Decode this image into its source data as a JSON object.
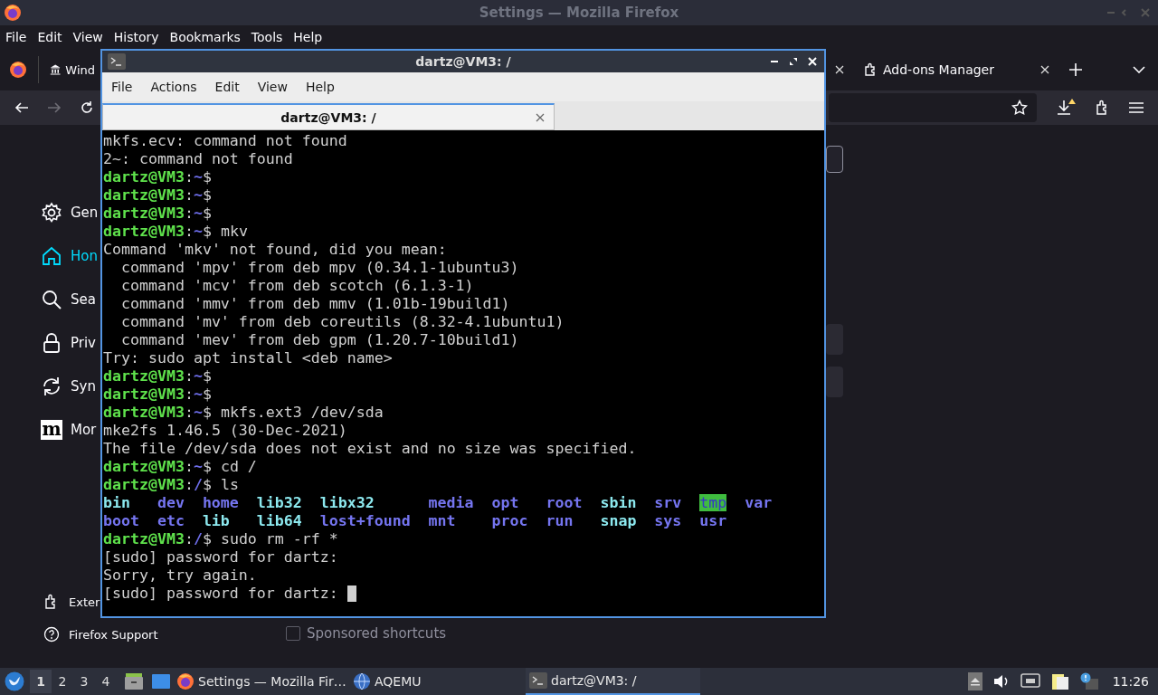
{
  "window": {
    "title": "Settings — Mozilla Firefox"
  },
  "menu": [
    "File",
    "Edit",
    "View",
    "History",
    "Bookmarks",
    "Tools",
    "Help"
  ],
  "tabs": [
    {
      "label": "Wind",
      "selected": false
    },
    {
      "selected": false
    },
    {
      "label": "Add-ons Manager",
      "selected": false
    }
  ],
  "sidebar": {
    "items": [
      {
        "label": "Gen",
        "selected": false
      },
      {
        "label": "Hon",
        "selected": true
      },
      {
        "label": "Sea",
        "selected": false
      },
      {
        "label": "Priv",
        "selected": false
      },
      {
        "label": "Syn",
        "selected": false
      },
      {
        "label": "Mor",
        "selected": false,
        "logo_text": "m"
      }
    ],
    "footer": [
      {
        "label": "Exter"
      },
      {
        "label": "Firefox Support"
      }
    ]
  },
  "sponsored": {
    "label": "Sponsored shortcuts",
    "checked": false,
    "disabled": true
  },
  "terminal": {
    "title": "dartz@VM3: /",
    "menu": [
      "File",
      "Actions",
      "Edit",
      "View",
      "Help"
    ],
    "tab": {
      "label": "dartz@VM3: /",
      "selected": true
    },
    "lines": [
      {
        "kind": "text",
        "segments": [
          {
            "text": "mkfs.ecv: command not found",
            "kind": "plain"
          }
        ]
      },
      {
        "kind": "text",
        "segments": [
          {
            "text": "2~: command not found",
            "kind": "plain"
          }
        ]
      },
      {
        "kind": "text",
        "segments": [
          {
            "text": "dartz@VM3",
            "kind": "user"
          },
          {
            "text": ":",
            "kind": "plain"
          },
          {
            "text": "~",
            "kind": "path"
          },
          {
            "text": "$",
            "kind": "plain"
          }
        ]
      },
      {
        "kind": "text",
        "segments": [
          {
            "text": "dartz@VM3",
            "kind": "user"
          },
          {
            "text": ":",
            "kind": "plain"
          },
          {
            "text": "~",
            "kind": "path"
          },
          {
            "text": "$",
            "kind": "plain"
          }
        ]
      },
      {
        "kind": "text",
        "segments": [
          {
            "text": "dartz@VM3",
            "kind": "user"
          },
          {
            "text": ":",
            "kind": "plain"
          },
          {
            "text": "~",
            "kind": "path"
          },
          {
            "text": "$",
            "kind": "plain"
          }
        ]
      },
      {
        "kind": "text",
        "segments": [
          {
            "text": "dartz@VM3",
            "kind": "user"
          },
          {
            "text": ":",
            "kind": "plain"
          },
          {
            "text": "~",
            "kind": "path"
          },
          {
            "text": "$ mkv",
            "kind": "plain"
          }
        ]
      },
      {
        "kind": "text",
        "segments": [
          {
            "text": "Command 'mkv' not found, did you mean:",
            "kind": "plain"
          }
        ]
      },
      {
        "kind": "text",
        "segments": [
          {
            "text": "  command 'mpv' from deb mpv (0.34.1-1ubuntu3)",
            "kind": "plain"
          }
        ]
      },
      {
        "kind": "text",
        "segments": [
          {
            "text": "  command 'mcv' from deb scotch (6.1.3-1)",
            "kind": "plain"
          }
        ]
      },
      {
        "kind": "text",
        "segments": [
          {
            "text": "  command 'mmv' from deb mmv (1.01b-19build1)",
            "kind": "plain"
          }
        ]
      },
      {
        "kind": "text",
        "segments": [
          {
            "text": "  command 'mv' from deb coreutils (8.32-4.1ubuntu1)",
            "kind": "plain"
          }
        ]
      },
      {
        "kind": "text",
        "segments": [
          {
            "text": "  command 'mev' from deb gpm (1.20.7-10build1)",
            "kind": "plain"
          }
        ]
      },
      {
        "kind": "text",
        "segments": [
          {
            "text": "Try: sudo apt install <deb name>",
            "kind": "plain"
          }
        ]
      },
      {
        "kind": "text",
        "segments": [
          {
            "text": "dartz@VM3",
            "kind": "user"
          },
          {
            "text": ":",
            "kind": "plain"
          },
          {
            "text": "~",
            "kind": "path"
          },
          {
            "text": "$",
            "kind": "plain"
          }
        ]
      },
      {
        "kind": "text",
        "segments": [
          {
            "text": "dartz@VM3",
            "kind": "user"
          },
          {
            "text": ":",
            "kind": "plain"
          },
          {
            "text": "~",
            "kind": "path"
          },
          {
            "text": "$",
            "kind": "plain"
          }
        ]
      },
      {
        "kind": "text",
        "segments": [
          {
            "text": "dartz@VM3",
            "kind": "user"
          },
          {
            "text": ":",
            "kind": "plain"
          },
          {
            "text": "~",
            "kind": "path"
          },
          {
            "text": "$ mkfs.ext3 /dev/sda",
            "kind": "plain"
          }
        ]
      },
      {
        "kind": "text",
        "segments": [
          {
            "text": "mke2fs 1.46.5 (30-Dec-2021)",
            "kind": "plain"
          }
        ]
      },
      {
        "kind": "text",
        "segments": [
          {
            "text": "The file /dev/sda does not exist and no size was specified.",
            "kind": "plain"
          }
        ]
      },
      {
        "kind": "text",
        "segments": [
          {
            "text": "dartz@VM3",
            "kind": "user"
          },
          {
            "text": ":",
            "kind": "plain"
          },
          {
            "text": "~",
            "kind": "path"
          },
          {
            "text": "$ cd /",
            "kind": "plain"
          }
        ]
      },
      {
        "kind": "text",
        "segments": [
          {
            "text": "dartz@VM3",
            "kind": "user"
          },
          {
            "text": ":",
            "kind": "plain"
          },
          {
            "text": "/",
            "kind": "path"
          },
          {
            "text": "$ ls",
            "kind": "plain"
          }
        ]
      },
      {
        "kind": "listing",
        "entries": [
          {
            "text": "bin",
            "kind": "link"
          },
          {
            "text": "dev",
            "kind": "dir"
          },
          {
            "text": "home",
            "kind": "dir"
          },
          {
            "text": "lib32",
            "kind": "link"
          },
          {
            "text": "libx32",
            "kind": "link"
          },
          {
            "text": "media",
            "kind": "dir"
          },
          {
            "text": "opt",
            "kind": "dir"
          },
          {
            "text": "root",
            "kind": "dir"
          },
          {
            "text": "sbin",
            "kind": "link"
          },
          {
            "text": "srv",
            "kind": "dir"
          },
          {
            "text": "tmp",
            "kind": "sticky"
          },
          {
            "text": "var",
            "kind": "dir"
          }
        ]
      },
      {
        "kind": "listing",
        "entries": [
          {
            "text": "boot",
            "kind": "dir"
          },
          {
            "text": "etc",
            "kind": "dir"
          },
          {
            "text": "lib",
            "kind": "link"
          },
          {
            "text": "lib64",
            "kind": "link"
          },
          {
            "text": "lost+found",
            "kind": "dir"
          },
          {
            "text": "mnt",
            "kind": "dir"
          },
          {
            "text": "proc",
            "kind": "dir"
          },
          {
            "text": "run",
            "kind": "dir"
          },
          {
            "text": "snap",
            "kind": "link"
          },
          {
            "text": "sys",
            "kind": "dir"
          },
          {
            "text": "usr",
            "kind": "dir"
          }
        ]
      },
      {
        "kind": "text",
        "segments": [
          {
            "text": "dartz@VM3",
            "kind": "user"
          },
          {
            "text": ":",
            "kind": "plain"
          },
          {
            "text": "/",
            "kind": "path"
          },
          {
            "text": "$ sudo rm -rf *",
            "kind": "plain"
          }
        ]
      },
      {
        "kind": "text",
        "segments": [
          {
            "text": "[sudo] password for dartz:",
            "kind": "plain"
          }
        ]
      },
      {
        "kind": "text",
        "segments": [
          {
            "text": "Sorry, try again.",
            "kind": "plain"
          }
        ]
      },
      {
        "kind": "text",
        "segments": [
          {
            "text": "[sudo] password for dartz:",
            "kind": "plain"
          }
        ],
        "cursor": true
      }
    ]
  },
  "taskbar": {
    "workspaces": [
      {
        "label": "1",
        "selected": true
      },
      {
        "label": "2",
        "selected": false
      },
      {
        "label": "3",
        "selected": false
      },
      {
        "label": "4",
        "selected": false
      }
    ],
    "tasks": [
      {
        "label": "Settings — Mozilla Fir…",
        "selected": false
      },
      {
        "label": "AQEMU",
        "selected": false
      },
      {
        "label": "dartz@VM3: /",
        "selected": true
      }
    ],
    "clock": "11:26"
  }
}
